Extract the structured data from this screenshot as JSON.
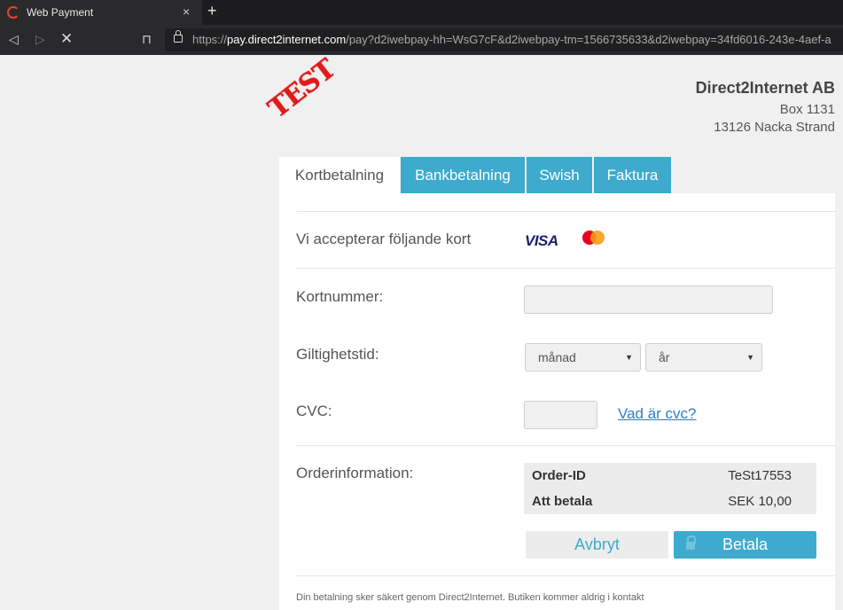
{
  "browser": {
    "tab_title": "Web Payment",
    "tab_close": "×",
    "new_tab": "+",
    "url_scheme": "https://",
    "url_host": "pay.direct2internet.com",
    "url_rest": "/pay?d2iwebpay-hh=WsG7cF&d2iwebpay-tm=1566735633&d2iwebpay=34fd6016-243e-4aef-a"
  },
  "stamp": "TEST",
  "merchant": {
    "name": "Direct2Internet AB",
    "address1": "Box 1131",
    "address2": "13126 Nacka Strand"
  },
  "tabs": [
    {
      "label": "Kortbetalning"
    },
    {
      "label": "Bankbetalning"
    },
    {
      "label": "Swish"
    },
    {
      "label": "Faktura"
    }
  ],
  "form": {
    "accepted_cards_label": "Vi accepterar följande kort",
    "visa_logo": "VISA",
    "card_number_label": "Kortnummer:",
    "card_number_value": "",
    "expiry_label": "Giltighetstid:",
    "month_selected": "månad",
    "year_selected": "år",
    "cvc_label": "CVC:",
    "cvc_value": "",
    "cvc_help_link": "Vad är cvc?",
    "order_label": "Orderinformation:",
    "order": [
      {
        "key": "Order-ID",
        "value": "TeSt17553"
      },
      {
        "key": "Att betala",
        "value": "SEK 10,00"
      }
    ],
    "cancel_button": "Avbryt",
    "pay_button": "Betala",
    "footer_text": "Din betalning sker säkert genom Direct2Internet. Butiken kommer aldrig i kontakt"
  },
  "colors": {
    "accent": "#3eaacd",
    "stamp_red": "#e11a1a",
    "link": "#2f7fbf"
  }
}
